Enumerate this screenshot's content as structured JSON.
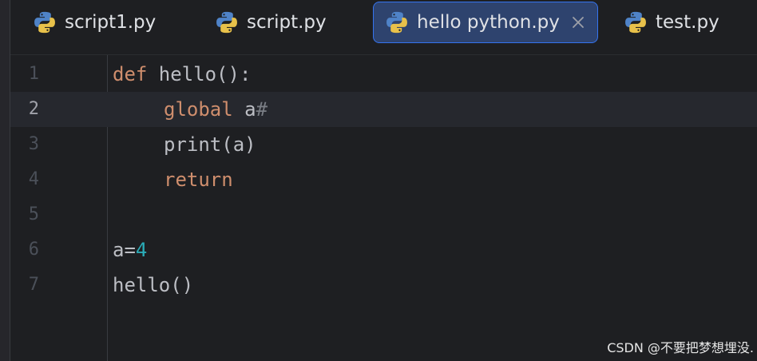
{
  "tabs": [
    {
      "label": "script1.py",
      "active": false
    },
    {
      "label": "script.py",
      "active": false
    },
    {
      "label": "hello python.py",
      "active": true
    },
    {
      "label": "test.py",
      "active": false
    }
  ],
  "editor": {
    "current_line": 2,
    "lines": [
      {
        "number": "1",
        "tokens": {
          "kw": "def",
          "text": " hello():"
        }
      },
      {
        "number": "2",
        "tokens": {
          "kw": "global",
          "text": " a",
          "comment": "#"
        }
      },
      {
        "number": "3",
        "tokens": {
          "text": "print(a)"
        }
      },
      {
        "number": "4",
        "tokens": {
          "kw": "return"
        }
      },
      {
        "number": "5",
        "tokens": {}
      },
      {
        "number": "6",
        "tokens": {
          "text": "a=",
          "num": "4"
        }
      },
      {
        "number": "7",
        "tokens": {
          "text": "hello()"
        }
      }
    ]
  },
  "watermark": "CSDN @不要把梦想埋没.",
  "colors": {
    "background": "#1e1f22",
    "active_tab_bg": "#2e436e",
    "active_tab_border": "#3574f0",
    "keyword": "#cf8e6d",
    "number": "#2aacb8",
    "text": "#bcbec4",
    "line_number": "#4b5059"
  },
  "icons": {
    "file_type": "python-icon",
    "tab_close": "close-icon"
  }
}
